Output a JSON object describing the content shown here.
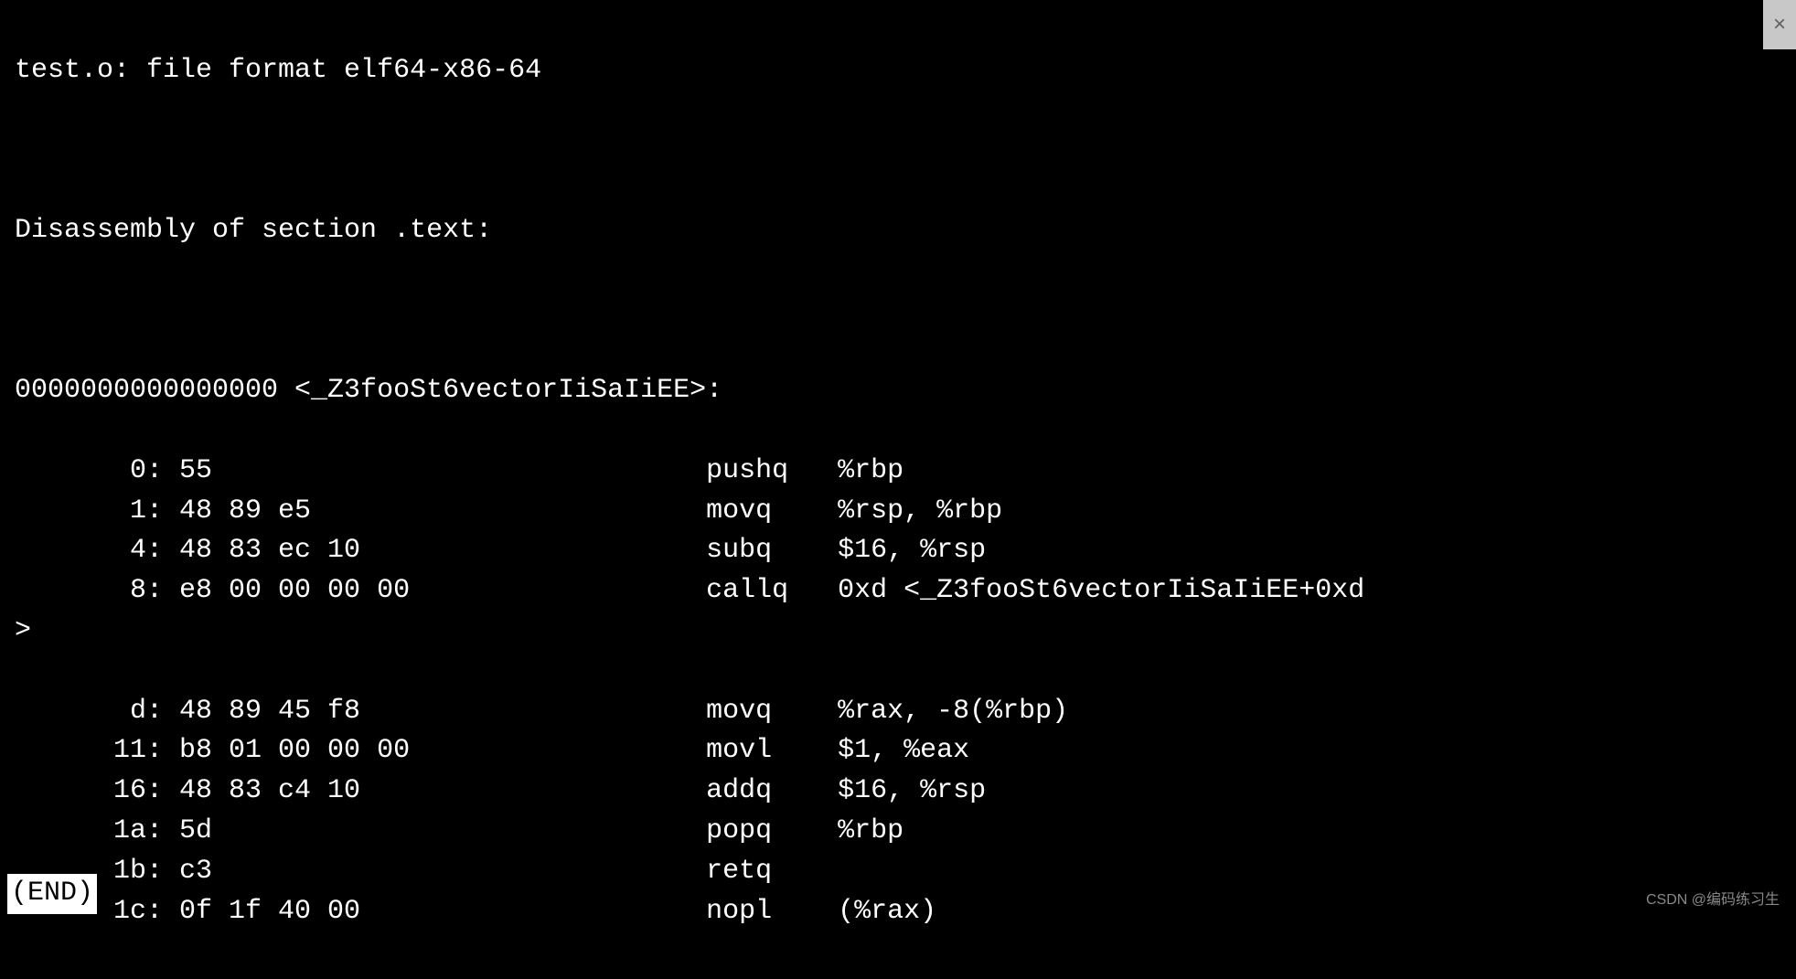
{
  "header": {
    "file_format_line": "test.o: file format elf64-x86-64",
    "section_heading": "Disassembly of section .text:",
    "symbol_line": "0000000000000000 <_Z3fooSt6vectorIiSaIiEE>:"
  },
  "rows": [
    {
      "offset": "0",
      "bytes": "55",
      "mnemonic": "pushq",
      "operands": "%rbp"
    },
    {
      "offset": "1",
      "bytes": "48 89 e5",
      "mnemonic": "movq",
      "operands": "%rsp, %rbp"
    },
    {
      "offset": "4",
      "bytes": "48 83 ec 10",
      "mnemonic": "subq",
      "operands": "$16, %rsp"
    },
    {
      "offset": "8",
      "bytes": "e8 00 00 00 00",
      "mnemonic": "callq",
      "operands": "0xd <_Z3fooSt6vectorIiSaIiEE+0xd"
    },
    {
      "offset": "d",
      "bytes": "48 89 45 f8",
      "mnemonic": "movq",
      "operands": "%rax, -8(%rbp)"
    },
    {
      "offset": "11",
      "bytes": "b8 01 00 00 00",
      "mnemonic": "movl",
      "operands": "$1, %eax"
    },
    {
      "offset": "16",
      "bytes": "48 83 c4 10",
      "mnemonic": "addq",
      "operands": "$16, %rsp"
    },
    {
      "offset": "1a",
      "bytes": "5d",
      "mnemonic": "popq",
      "operands": "%rbp"
    },
    {
      "offset": "1b",
      "bytes": "c3",
      "mnemonic": "retq",
      "operands": ""
    },
    {
      "offset": "1c",
      "bytes": "0f 1f 40 00",
      "mnemonic": "nopl",
      "operands": "(%rax)"
    }
  ],
  "wrap_continuation": ">",
  "end_marker": "(END)",
  "watermark": "CSDN @编码练习生",
  "close_icon": "×"
}
